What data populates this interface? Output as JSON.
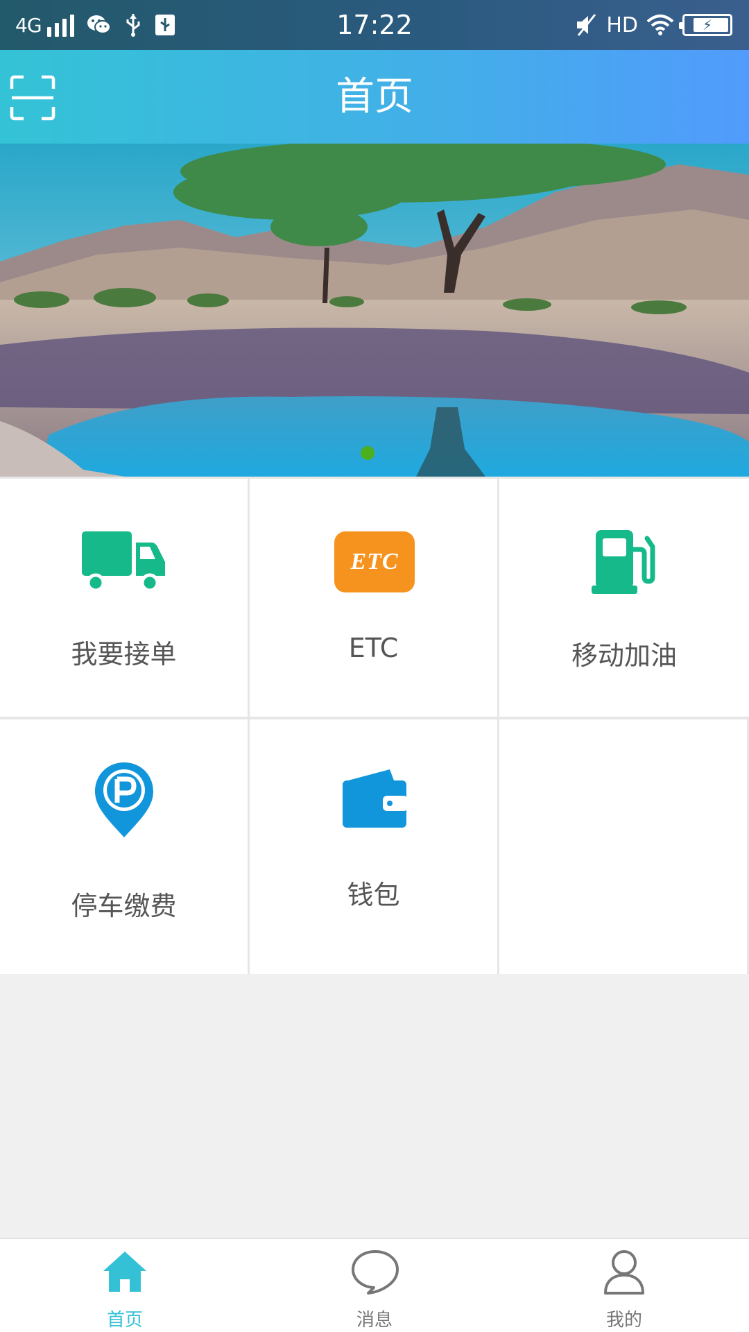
{
  "status_bar": {
    "network": "4G",
    "time": "17:22",
    "hd": "HD",
    "icons": [
      "signal-icon",
      "wechat-icon",
      "usb-icon",
      "usb-debug-icon",
      "mute-icon",
      "wifi-icon",
      "battery-icon"
    ]
  },
  "header": {
    "title": "首页",
    "scan_icon": "scan-icon"
  },
  "banner": {
    "slide_count_visible": 1,
    "active_indicator_color": "#4caf1d"
  },
  "grid": {
    "items": [
      {
        "label": "我要接单",
        "icon": "truck-icon",
        "color": "#15b98a"
      },
      {
        "label": "ETC",
        "icon": "etc-icon",
        "color": "#f5931e",
        "icon_text": "ETC"
      },
      {
        "label": "移动加油",
        "icon": "fuel-pump-icon",
        "color": "#15b98a"
      },
      {
        "label": "停车缴费",
        "icon": "parking-pin-icon",
        "color": "#1296db"
      },
      {
        "label": "钱包",
        "icon": "wallet-icon",
        "color": "#1296db"
      }
    ]
  },
  "bottom_nav": {
    "active_color": "#35c1d5",
    "inactive_color": "#777777",
    "items": [
      {
        "label": "首页",
        "icon": "home-icon",
        "active": true
      },
      {
        "label": "消息",
        "icon": "chat-bubble-icon",
        "active": false
      },
      {
        "label": "我的",
        "icon": "user-icon",
        "active": false
      }
    ]
  }
}
